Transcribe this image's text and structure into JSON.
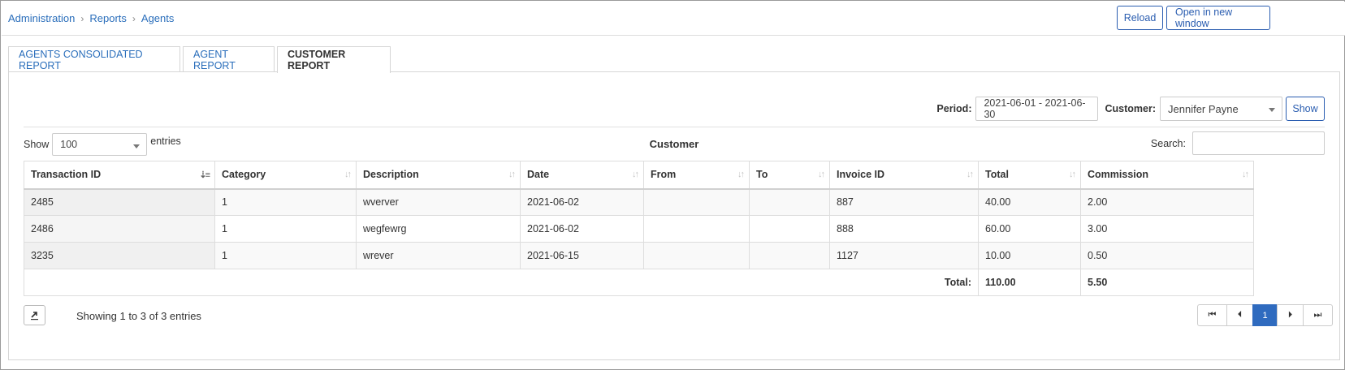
{
  "breadcrumb": [
    "Administration",
    "Reports",
    "Agents"
  ],
  "header": {
    "reload_label": "Reload",
    "open_new_window_label": "Open in new window"
  },
  "tabs": [
    {
      "label": "AGENTS CONSOLIDATED REPORT",
      "active": false
    },
    {
      "label": "AGENT REPORT",
      "active": false
    },
    {
      "label": "CUSTOMER REPORT",
      "active": true
    }
  ],
  "filters": {
    "period_label": "Period:",
    "period_value": "2021-06-01 - 2021-06-30",
    "customer_label": "Customer:",
    "customer_value": "Jennifer Payne",
    "show_label": "Show"
  },
  "table_controls": {
    "show_prefix": "Show",
    "entries_value": "100",
    "entries_suffix": "entries",
    "title": "Customer",
    "search_label": "Search:",
    "search_value": ""
  },
  "table": {
    "columns": [
      "Transaction ID",
      "Category",
      "Description",
      "Date",
      "From",
      "To",
      "Invoice ID",
      "Total",
      "Commission"
    ],
    "rows": [
      [
        "2485",
        "1",
        "wverver",
        "2021-06-02",
        "",
        "",
        "887",
        "40.00",
        "2.00"
      ],
      [
        "2486",
        "1",
        "wegfewrg",
        "2021-06-02",
        "",
        "",
        "888",
        "60.00",
        "3.00"
      ],
      [
        "3235",
        "1",
        "wrever",
        "2021-06-15",
        "",
        "",
        "1127",
        "10.00",
        "0.50"
      ]
    ],
    "footer": {
      "label": "Total:",
      "total": "110.00",
      "commission": "5.50"
    }
  },
  "footer": {
    "info": "Showing 1 to 3 of 3 entries",
    "pagination": {
      "first": "⏮",
      "prev": "⏴",
      "current": "1",
      "next": "⏵",
      "last": "⏭"
    }
  },
  "colors": {
    "accent": "#2f6bbf",
    "link": "#2a6ebb"
  },
  "icons": [
    "chevron-right-icon",
    "sort-icon",
    "sort-ascending-icon",
    "export-icon",
    "first-page-icon",
    "previous-page-icon",
    "next-page-icon",
    "last-page-icon",
    "dropdown-arrow-icon"
  ]
}
